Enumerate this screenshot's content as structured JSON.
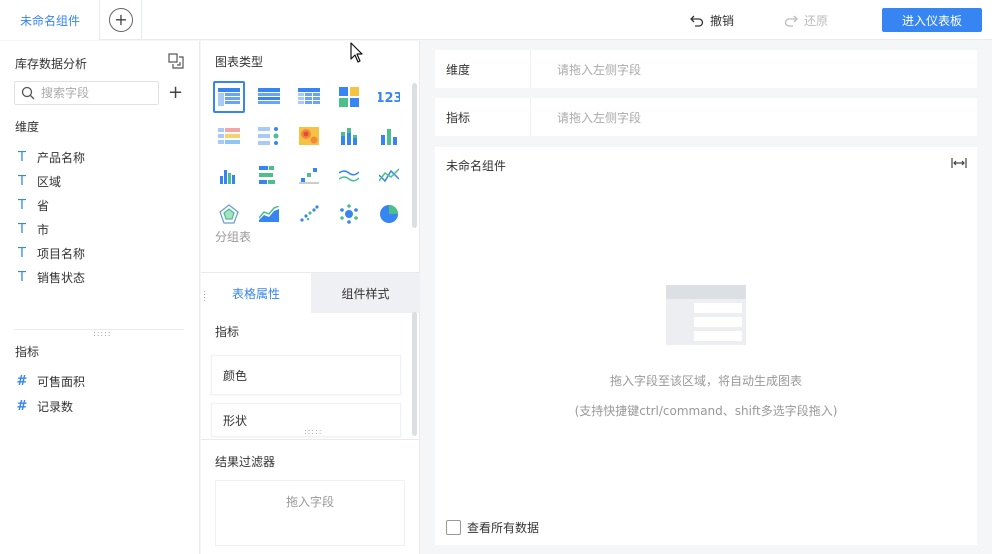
{
  "topbar": {
    "tab_label": "未命名组件",
    "undo_label": "撤销",
    "redo_label": "还原",
    "enter_dashboard_label": "进入仪表板"
  },
  "left_panel": {
    "dataset_title": "库存数据分析",
    "search_placeholder": "搜索字段",
    "dimension_label": "维度",
    "dimensions": [
      "产品名称",
      "区域",
      "省",
      "市",
      "项目名称",
      "销售状态"
    ],
    "measure_label": "指标",
    "measures": [
      "可售面积",
      "记录数"
    ]
  },
  "chart_types": {
    "title": "图表类型",
    "group_label": "分组表",
    "icons": [
      "grouped-table-icon",
      "detail-table-icon",
      "cross-table-icon",
      "color-block-icon",
      "kpi-number-icon",
      "heat-table-icon",
      "dot-table-icon",
      "heatmap-icon",
      "stacked-bar-icon",
      "bar-chart-icon",
      "column-chart-icon",
      "horizontal-bar-icon",
      "scatter-step-icon",
      "multi-line-icon",
      "line-chart-icon",
      "radar-icon",
      "area-icon",
      "scatter-icon",
      "bubble-icon",
      "pie-icon"
    ],
    "selected_index": 0
  },
  "properties": {
    "tab_table_attr": "表格属性",
    "tab_component_style": "组件样式",
    "measure_label": "指标",
    "color_label": "颜色",
    "shape_label": "形状",
    "filter_title": "结果过滤器",
    "filter_placeholder": "拖入字段"
  },
  "canvas": {
    "dimension_label": "维度",
    "dimension_placeholder": "请拖入左侧字段",
    "measure_label": "指标",
    "measure_placeholder": "请拖入左侧字段",
    "widget_title": "未命名组件",
    "empty_hint": "拖入字段至该区域，将自动生成图表",
    "empty_hint_sub": "(支持快捷键ctrl/command、shift多选字段拖入)",
    "view_all_label": "查看所有数据"
  },
  "colors": {
    "accent": "#3685f2",
    "panel_bg": "#f5f6f8"
  }
}
